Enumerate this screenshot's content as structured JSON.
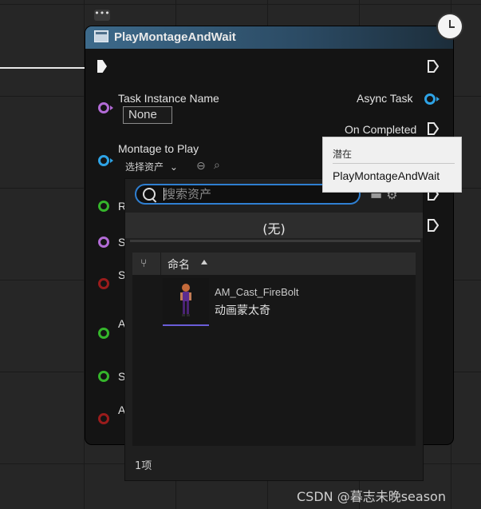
{
  "node": {
    "title": "PlayMontageAndWait",
    "inputs": {
      "task_instance_name": {
        "label": "Task Instance Name",
        "value": "None"
      },
      "montage_to_play": {
        "label": "Montage to Play",
        "selected": "选择资产"
      },
      "partial_labels": [
        "R",
        "S",
        "S",
        "A",
        "S",
        "A"
      ]
    },
    "outputs": {
      "async_task": "Async Task",
      "on_completed": "On Completed"
    }
  },
  "tooltip": {
    "category": "潜在",
    "text": "PlayMontageAndWait"
  },
  "asset_picker": {
    "search_placeholder": "搜索资产",
    "none_option": "(无)",
    "column_name": "命名",
    "assets": [
      {
        "name": "AM_Cast_FireBolt",
        "type": "动画蒙太奇"
      }
    ],
    "item_count": "1项"
  },
  "watermark": "CSDN @暮志未晚season",
  "colors": {
    "header_blue": "#3d6a8b",
    "pin_purple": "#b26bd6",
    "pin_blue": "#2ea3e6",
    "pin_green": "#35b52b",
    "pin_red": "#9a1c1c",
    "search_border": "#2f7fd1"
  }
}
